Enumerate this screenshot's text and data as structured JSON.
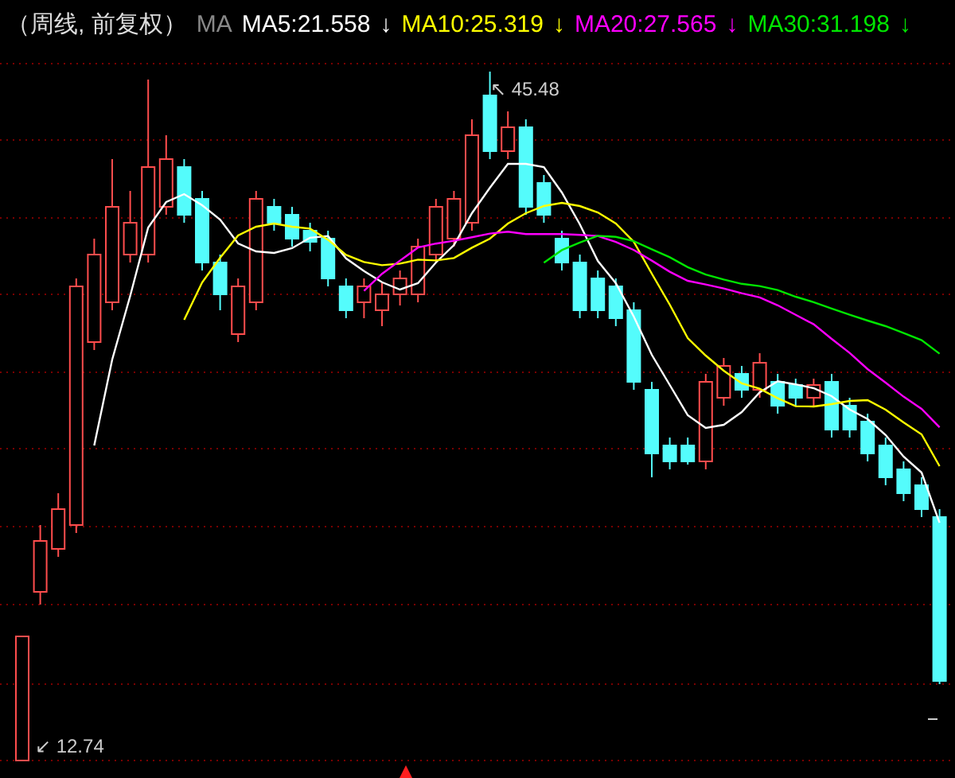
{
  "header": {
    "title": "（周线, 前复权）",
    "label": "MA",
    "indicators": [
      {
        "text": "MA5:21.558",
        "arrow": "↓",
        "color": "#ffffff"
      },
      {
        "text": "MA10:25.319",
        "arrow": "↓",
        "color": "#ffff00"
      },
      {
        "text": "MA20:27.565",
        "arrow": "↓",
        "color": "#ff00ff"
      },
      {
        "text": "MA30:31.198",
        "arrow": "↓",
        "color": "#00e600"
      }
    ]
  },
  "chart": {
    "annotations": [
      {
        "kind": "high",
        "text": "↖ 45.48"
      },
      {
        "kind": "low",
        "text": "↙ 12.74"
      }
    ]
  }
}
